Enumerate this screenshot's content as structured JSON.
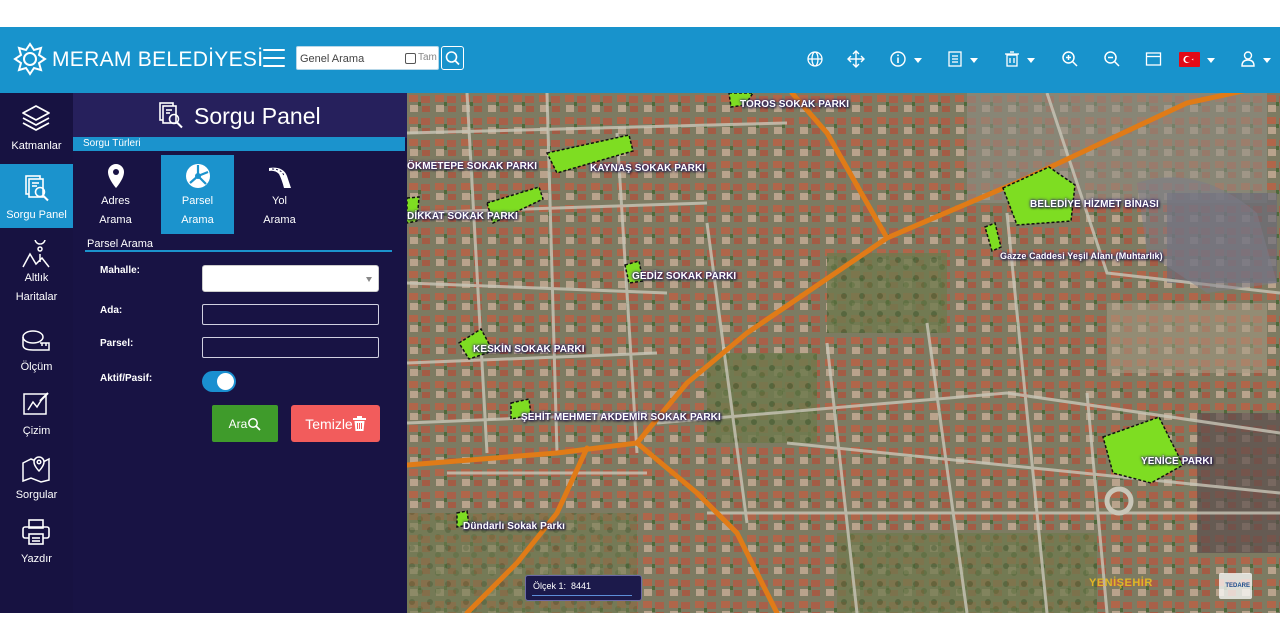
{
  "header": {
    "brand": "MERAM BELEDİYESİ",
    "search_placeholder": "Genel Arama",
    "tam_label": "Tam",
    "accent": "#1893cc",
    "tools": [
      "globe-icon",
      "move-icon",
      "info-icon",
      "list-icon",
      "trash-icon",
      "zoom-in-icon",
      "zoom-out-icon",
      "window-icon",
      "flag-tr-icon",
      "user-icon"
    ]
  },
  "sidebar": {
    "items": [
      {
        "label": "Katmanlar",
        "icon": "layers-icon"
      },
      {
        "label": "Sorgu Panel",
        "icon": "query-icon",
        "active": true
      },
      {
        "label": "Altlık",
        "label2": "Haritalar",
        "icon": "basemap-icon"
      },
      {
        "label": "Ölçüm",
        "icon": "ruler-icon"
      },
      {
        "label": "Çizim",
        "icon": "draw-icon"
      },
      {
        "label": "Sorgular",
        "icon": "map-queries-icon"
      },
      {
        "label": "Yazdır",
        "icon": "printer-icon"
      }
    ]
  },
  "panel": {
    "title": "Sorgu Panel",
    "types_label": "Sorgu Türleri",
    "query_types": [
      {
        "line1": "Adres",
        "line2": "Arama",
        "icon": "location-pin-icon"
      },
      {
        "line1": "Parsel",
        "line2": "Arama",
        "icon": "parcel-icon",
        "active": true
      },
      {
        "line1": "Yol",
        "line2": "Arama",
        "icon": "road-icon"
      }
    ],
    "section_label": "Parsel Arama",
    "mahalle_label": "Mahalle:",
    "ada_label": "Ada:",
    "parsel_label": "Parsel:",
    "aktif_label": "Aktif/Pasif:",
    "aktif_on": true,
    "search_button": "Ara",
    "clear_button": "Temizle"
  },
  "map": {
    "scale_label": "Ölçek 1:",
    "scale_value": "8441",
    "district_label": "YENİŞEHİR",
    "watermark": "TEDARE",
    "parks": [
      "TOROS SOKAK PARKI",
      "ÖKMETEPE SOKAK PARKI",
      "KAYNAŞ SOKAK PARKI",
      "DİKKAT SOKAK PARKI",
      "BELEDİYE HİZMET BİNASI",
      "Gazze Caddesi Yeşil Alanı (Muhtarlık)",
      "GEDİZ SOKAK PARKI",
      "KESKİN SOKAK PARKI",
      "ŞEHİT MEHMET AKDEMİR SOKAK PARKI",
      "YENİCE PARKI",
      "Dündarlı Sokak Parkı"
    ]
  }
}
